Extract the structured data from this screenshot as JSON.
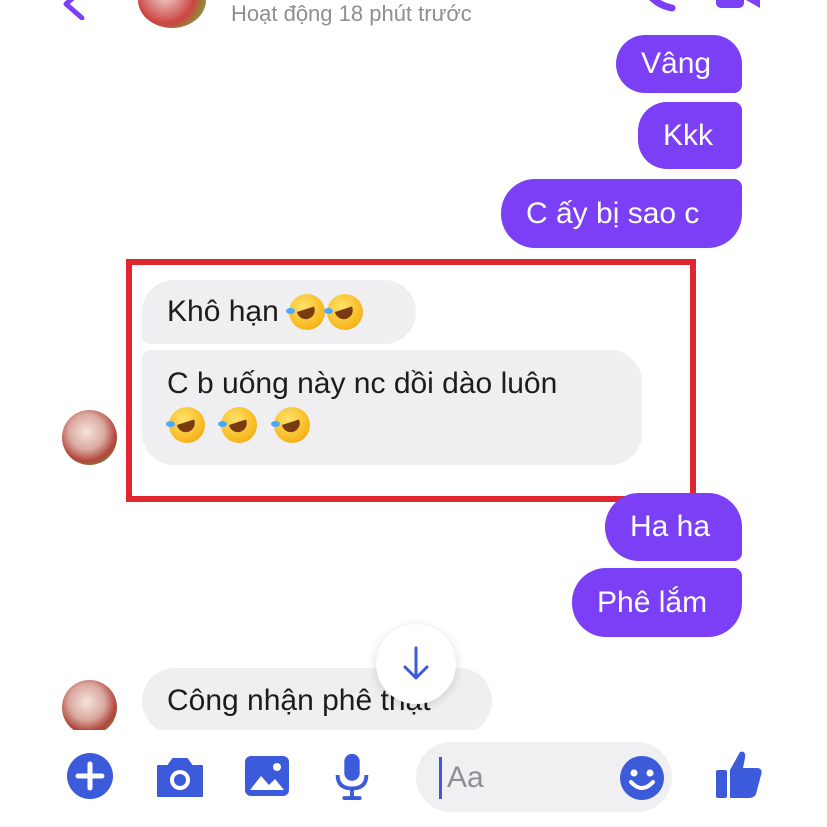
{
  "header": {
    "status": "Hoạt động 18 phút trước"
  },
  "messages": [
    {
      "direction": "out",
      "text": "Vâng"
    },
    {
      "direction": "out",
      "text": "Kkk"
    },
    {
      "direction": "out",
      "text": "C ấy bị sao c"
    },
    {
      "direction": "in",
      "text": "Khô hạn",
      "emoji": [
        "rofl-emoji",
        "rofl-emoji"
      ]
    },
    {
      "direction": "in",
      "text": "C b uống này nc dồi dào luôn",
      "emoji": [
        "rofl-emoji",
        "rofl-emoji",
        "rofl-emoji"
      ]
    },
    {
      "direction": "out",
      "text": "Ha ha"
    },
    {
      "direction": "out",
      "text": "Phê lắm"
    },
    {
      "direction": "in",
      "text": "Công nhận phê thật"
    }
  ],
  "composer": {
    "placeholder": "Aa",
    "icons": [
      "plus-icon",
      "camera-icon",
      "image-icon",
      "microphone-icon",
      "emoji-icon",
      "thumbs-up-icon"
    ]
  },
  "colors": {
    "outgoing_bubble": "#7b3ff6",
    "incoming_bubble": "#efeff1",
    "accent": "#3b5bdb",
    "highlight_box": "#e0262f"
  }
}
